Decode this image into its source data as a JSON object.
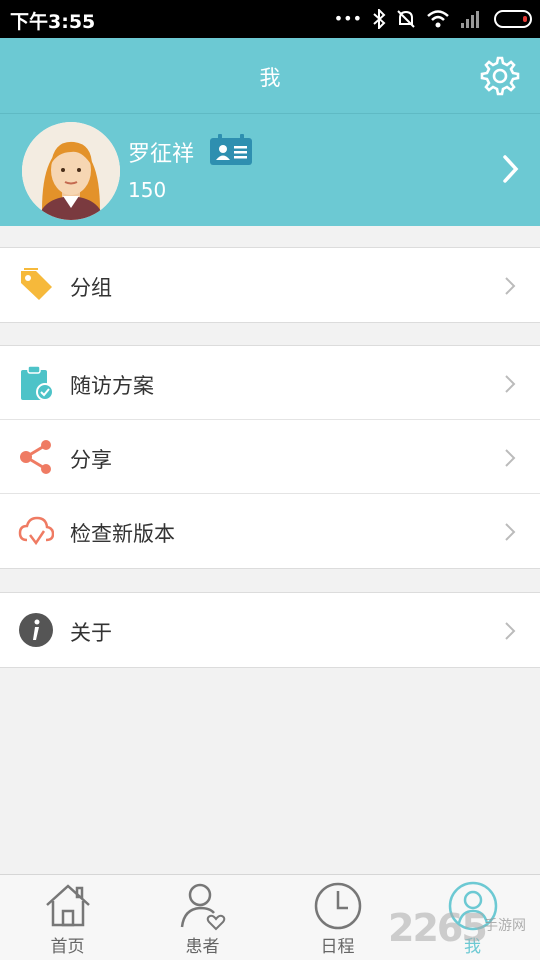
{
  "status_bar": {
    "time": "下午3:55"
  },
  "header": {
    "title": "我"
  },
  "profile": {
    "name": "罗征祥",
    "points": "150"
  },
  "menu_groups": [
    {
      "items": [
        {
          "label": "分组",
          "icon": "tag-icon"
        }
      ]
    },
    {
      "items": [
        {
          "label": "随访方案",
          "icon": "clipboard-icon"
        },
        {
          "label": "分享",
          "icon": "share-icon"
        },
        {
          "label": "检查新版本",
          "icon": "cloud-check-icon"
        }
      ]
    },
    {
      "items": [
        {
          "label": "关于",
          "icon": "info-icon"
        }
      ]
    }
  ],
  "tabbar": {
    "tabs": [
      {
        "label": "首页",
        "icon": "home-icon"
      },
      {
        "label": "患者",
        "icon": "patient-icon"
      },
      {
        "label": "日程",
        "icon": "clock-icon"
      },
      {
        "label": "我",
        "icon": "user-icon",
        "active": true
      }
    ]
  },
  "watermark": {
    "number": "2265",
    "text": "手游网"
  },
  "colors": {
    "accent": "#6cc9d3",
    "tag": "#f6b93b",
    "clipboard": "#4dc3c8",
    "share": "#ef7b63",
    "info": "#555555"
  }
}
